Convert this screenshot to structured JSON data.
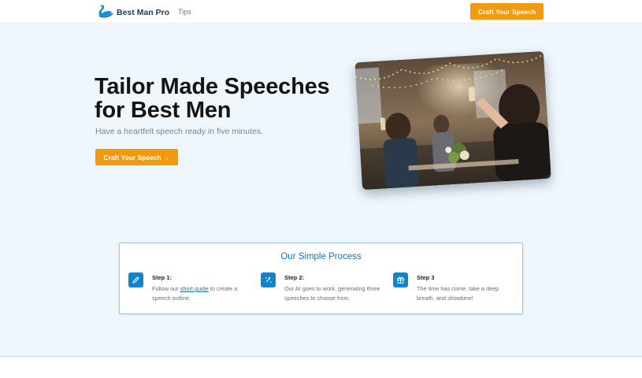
{
  "navbar": {
    "brand_name": "Best Man Pro",
    "links": [
      {
        "label": "Tips"
      }
    ],
    "cta_label": "Craft Your Speech"
  },
  "hero": {
    "title": "Tailor Made Speeches for Best Men",
    "subtitle": "Have a heartfelt speech ready in five minutes.",
    "cta_label": "Craft Your Speech →",
    "image_icon": "wedding-toast-photo"
  },
  "process": {
    "title": "Our Simple Process",
    "steps": [
      {
        "title": "Step 1:",
        "text_before": "Follow our ",
        "link": "short guide",
        "text_after": " to create a speech outline.",
        "icon": "pencil-icon"
      },
      {
        "title": "Step 2:",
        "text": "Our AI goes to work, generating three speeches to choose from.",
        "icon": "sparkle-icon"
      },
      {
        "title": "Step 3",
        "text": "The time has come, take a deep breath, and showtime!",
        "icon": "gift-icon"
      }
    ]
  },
  "colors": {
    "accent": "#f29a0e",
    "brand_blue": "#1484c9",
    "hero_bg": "#eff7fd"
  }
}
